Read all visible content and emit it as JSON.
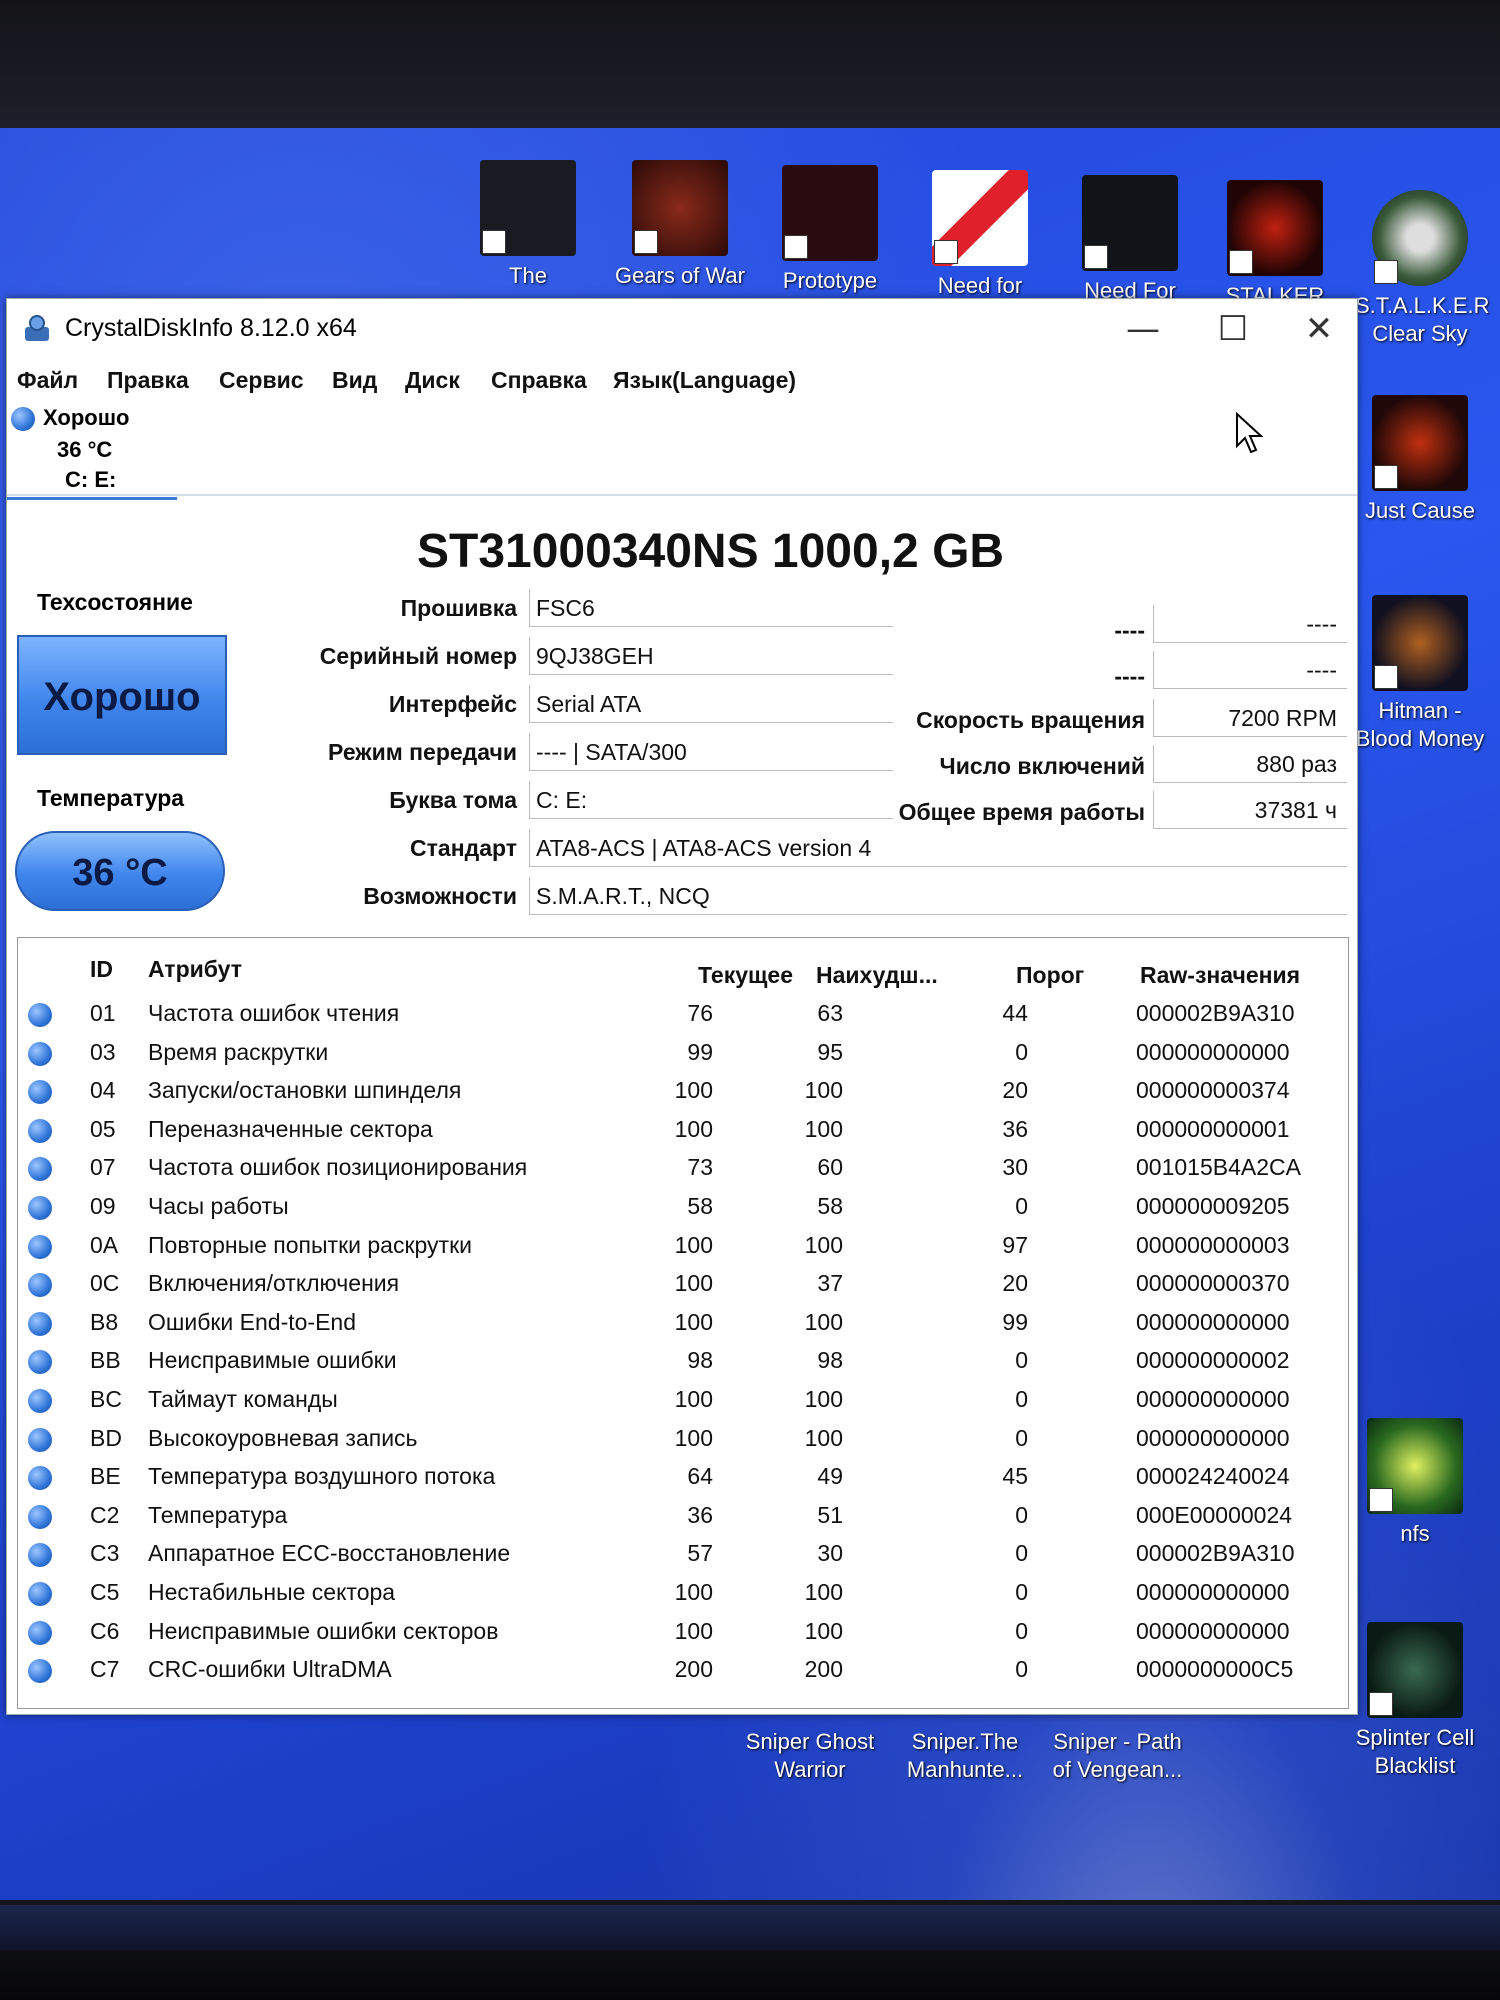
{
  "desktop": {
    "top_icons": [
      {
        "label": "The Chronicles"
      },
      {
        "label": "Gears of War"
      },
      {
        "label": "Prototype"
      },
      {
        "label": "Need for Speed Un..."
      },
      {
        "label": "Need For Speed Mos..."
      },
      {
        "label": "STALKER Call..."
      },
      {
        "label": "S.T.A.L.K.E.R Clear Sky"
      }
    ],
    "right_icons": [
      {
        "label": "Just Cause"
      },
      {
        "label": "Hitman - Blood Money"
      },
      {
        "label": "nfs"
      },
      {
        "label": "Splinter Cell Blacklist"
      }
    ],
    "bottom_icons": [
      {
        "label": "Sniper Ghost Warrior"
      },
      {
        "label": "Sniper.The Manhunte..."
      },
      {
        "label": "Sniper - Path of Vengean..."
      }
    ]
  },
  "window": {
    "title": "CrystalDiskInfo 8.12.0 x64",
    "controls": {
      "minimize": "—",
      "maximize": "☐",
      "close": "✕"
    },
    "menu": [
      "Файл",
      "Правка",
      "Сервис",
      "Вид",
      "Диск",
      "Справка",
      "Язык(Language)"
    ],
    "disk_tab": {
      "status": "Хорошо",
      "temp": "36 °C",
      "letters": "C: E:"
    }
  },
  "disk": {
    "model": "ST31000340NS 1000,2 GB",
    "health_label": "Техсостояние",
    "health_value": "Хорошо",
    "temp_label": "Температура",
    "temp_value": "36 °C",
    "left_fields": [
      {
        "label": "Прошивка",
        "value": "FSC6"
      },
      {
        "label": "Серийный номер",
        "value": "9QJ38GEH"
      },
      {
        "label": "Интерфейс",
        "value": "Serial ATA"
      },
      {
        "label": "Режим передачи",
        "value": "---- | SATA/300"
      },
      {
        "label": "Буква тома",
        "value": "C: E:"
      }
    ],
    "wide_fields": [
      {
        "label": "Стандарт",
        "value": "ATA8-ACS | ATA8-ACS version 4"
      },
      {
        "label": "Возможности",
        "value": "S.M.A.R.T., NCQ"
      }
    ],
    "right_fields": [
      {
        "label": "----",
        "value": "----"
      },
      {
        "label": "----",
        "value": "----"
      },
      {
        "label": "Скорость вращения",
        "value": "7200 RPM"
      },
      {
        "label": "Число включений",
        "value": "880 раз"
      },
      {
        "label": "Общее время работы",
        "value": "37381 ч"
      }
    ]
  },
  "smart": {
    "headers": {
      "id": "ID",
      "attr": "Атрибут",
      "current": "Текущее",
      "worst": "Наихудш...",
      "threshold": "Порог",
      "raw": "Raw-значения"
    },
    "rows": [
      {
        "id": "01",
        "name": "Частота ошибок чтения",
        "current": "76",
        "worst": "63",
        "threshold": "44",
        "raw": "000002B9A310"
      },
      {
        "id": "03",
        "name": "Время раскрутки",
        "current": "99",
        "worst": "95",
        "threshold": "0",
        "raw": "000000000000"
      },
      {
        "id": "04",
        "name": "Запуски/остановки шпинделя",
        "current": "100",
        "worst": "100",
        "threshold": "20",
        "raw": "000000000374"
      },
      {
        "id": "05",
        "name": "Переназначенные сектора",
        "current": "100",
        "worst": "100",
        "threshold": "36",
        "raw": "000000000001"
      },
      {
        "id": "07",
        "name": "Частота ошибок позиционирования",
        "current": "73",
        "worst": "60",
        "threshold": "30",
        "raw": "001015B4A2CA"
      },
      {
        "id": "09",
        "name": "Часы работы",
        "current": "58",
        "worst": "58",
        "threshold": "0",
        "raw": "000000009205"
      },
      {
        "id": "0A",
        "name": "Повторные попытки раскрутки",
        "current": "100",
        "worst": "100",
        "threshold": "97",
        "raw": "000000000003"
      },
      {
        "id": "0C",
        "name": "Включения/отключения",
        "current": "100",
        "worst": "37",
        "threshold": "20",
        "raw": "000000000370"
      },
      {
        "id": "B8",
        "name": "Ошибки End-to-End",
        "current": "100",
        "worst": "100",
        "threshold": "99",
        "raw": "000000000000"
      },
      {
        "id": "BB",
        "name": "Неисправимые ошибки",
        "current": "98",
        "worst": "98",
        "threshold": "0",
        "raw": "000000000002"
      },
      {
        "id": "BC",
        "name": "Таймаут команды",
        "current": "100",
        "worst": "100",
        "threshold": "0",
        "raw": "000000000000"
      },
      {
        "id": "BD",
        "name": "Высокоуровневая запись",
        "current": "100",
        "worst": "100",
        "threshold": "0",
        "raw": "000000000000"
      },
      {
        "id": "BE",
        "name": "Температура воздушного потока",
        "current": "64",
        "worst": "49",
        "threshold": "45",
        "raw": "000024240024"
      },
      {
        "id": "C2",
        "name": "Температура",
        "current": "36",
        "worst": "51",
        "threshold": "0",
        "raw": "000E00000024"
      },
      {
        "id": "C3",
        "name": "Аппаратное ECC-восстановление",
        "current": "57",
        "worst": "30",
        "threshold": "0",
        "raw": "000002B9A310"
      },
      {
        "id": "C5",
        "name": "Нестабильные сектора",
        "current": "100",
        "worst": "100",
        "threshold": "0",
        "raw": "000000000000"
      },
      {
        "id": "C6",
        "name": "Неисправимые ошибки секторов",
        "current": "100",
        "worst": "100",
        "threshold": "0",
        "raw": "000000000000"
      },
      {
        "id": "C7",
        "name": "CRC-ошибки UltraDMA",
        "current": "200",
        "worst": "200",
        "threshold": "0",
        "raw": "0000000000C5"
      }
    ]
  },
  "colors": {
    "good": "#3f86ec",
    "accent": "#3d79d8"
  }
}
